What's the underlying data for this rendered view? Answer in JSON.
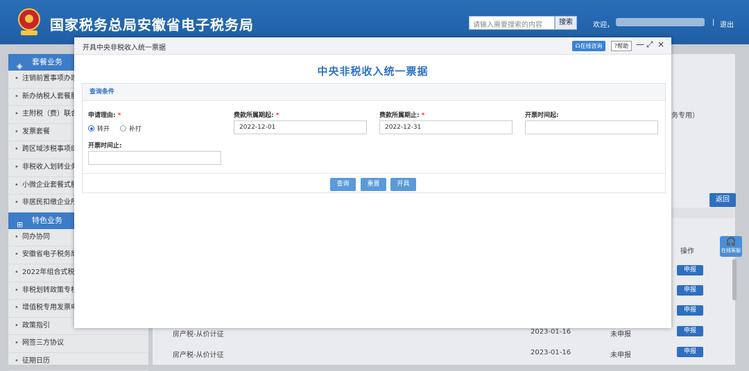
{
  "header": {
    "site_title": "国家税务总局安徽省电子税务局",
    "search_placeholder": "请输入需要搜索的内容",
    "search_button": "搜索",
    "welcome": "欢迎，",
    "separator": "|",
    "logout": "退出"
  },
  "sidebar": {
    "section1_title": "套餐业务",
    "section1_items": [
      "注销前置事项办理套",
      "新办纳税人套餐服务",
      "主附税（费）联合申",
      "发票套餐",
      "跨区域涉税事项综合",
      "非税收入划转业务专",
      "小微企业套餐式服务",
      "非居民扣缴企业所得"
    ],
    "section2_title": "特色业务",
    "section2_items": [
      "同办协同",
      "安徽省电子税务局",
      "2022年组合式税费",
      "非税划转政策专栏",
      "增值税专用发票电子",
      "政策指引",
      "网签三方协议",
      "征期日历"
    ]
  },
  "background": {
    "frag_specific": "务专用）",
    "back_button": "返回",
    "col_operation": "操作",
    "declare_label": "申报",
    "float_help": "在线客服",
    "rows": [
      {
        "name": "房产税-从价计征",
        "date": "2023-01-16",
        "status": "未申报"
      },
      {
        "name": "房产税-从价计征",
        "date": "2023-01-16",
        "status": "未申报"
      }
    ]
  },
  "modal": {
    "caption": "开具中央非税收入统一票据",
    "online_button": "在线咨询",
    "help_button": "帮助",
    "minimize": "—",
    "maximize": "⤢",
    "close": "×",
    "title": "中央非税收入统一票据",
    "query_header": "查询条件",
    "fields": {
      "reason_label": "申请理由:",
      "reason_opt1": "转开",
      "reason_opt2": "补打",
      "period_start_label": "费款所属期起:",
      "period_start_value": "2022-12-01",
      "period_end_label": "费款所属期止:",
      "period_end_value": "2022-12-31",
      "issue_start_label": "开票时间起:",
      "issue_start_value": "",
      "issue_end_label": "开票时间止:",
      "issue_end_value": ""
    },
    "required_mark": "*",
    "buttons": {
      "query": "查询",
      "reset": "重置",
      "issue": "开具"
    }
  }
}
